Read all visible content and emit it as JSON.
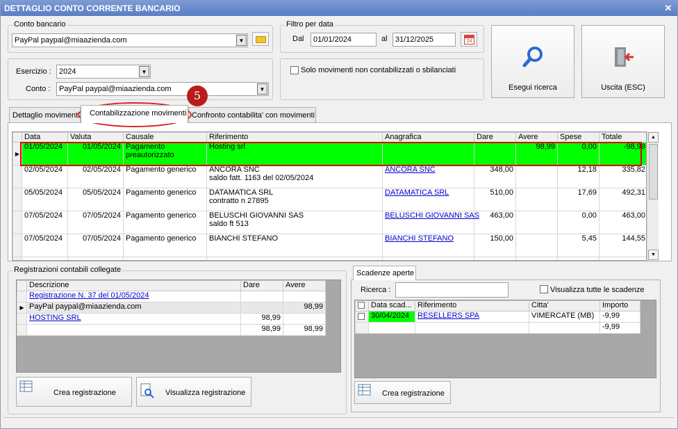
{
  "window": {
    "title": "DETTAGLIO CONTO CORRENTE BANCARIO",
    "close": "✕"
  },
  "conto_bancario": {
    "label": "Conto bancario",
    "value": "PayPal paypal@miaazienda.com"
  },
  "filtro": {
    "label": "Filtro per data",
    "dal_label": "Dal",
    "dal": "01/01/2024",
    "al_label": "al",
    "al": "31/12/2025",
    "cal": "24"
  },
  "esercizio": {
    "label": "Esercizio :",
    "value": "2024"
  },
  "conto": {
    "label": "Conto :",
    "value": "PayPal paypal@miaazienda.com"
  },
  "solo_movimenti": "Solo movimenti non contabilizzati o sbilanciati",
  "buttons": {
    "esegui": "Esegui ricerca",
    "uscita": "Uscita (ESC)"
  },
  "tabs": [
    "Dettaglio movimenti",
    "Contabilizzazione movimenti",
    "Confronto contabilita' con movimenti"
  ],
  "annotation": "5",
  "movimenti": {
    "columns": [
      "Data",
      "Valuta",
      "Causale",
      "Riferimento",
      "Anagrafica",
      "Dare",
      "Avere",
      "Spese",
      "Totale"
    ],
    "rows": [
      {
        "data": "01/05/2024",
        "valuta": "01/05/2024",
        "causale": "Pagamento",
        "causale2": "preautorizzato",
        "rif": "Hosting srl",
        "rif2": "",
        "anag": "",
        "dare": "",
        "avere": "98,99",
        "spese": "0,00",
        "totale": "-98,99"
      },
      {
        "data": "02/05/2024",
        "valuta": "02/05/2024",
        "causale": "Pagamento generico",
        "causale2": "",
        "rif": "ANCORA SNC",
        "rif2": "saldo fatt.   1163 del 02/05/2024",
        "anag": "ANCORA SNC",
        "dare": "348,00",
        "avere": "",
        "spese": "12,18",
        "totale": "335,82"
      },
      {
        "data": "05/05/2024",
        "valuta": "05/05/2024",
        "causale": "Pagamento generico",
        "causale2": "",
        "rif": "DATAMATICA SRL",
        "rif2": "contratto n 27895",
        "anag": "DATAMATICA SRL",
        "dare": "510,00",
        "avere": "",
        "spese": "17,69",
        "totale": "492,31"
      },
      {
        "data": "07/05/2024",
        "valuta": "07/05/2024",
        "causale": "Pagamento generico",
        "causale2": "",
        "rif": "BELUSCHI GIOVANNI SAS",
        "rif2": "saldo ft 513",
        "anag": "BELUSCHI GIOVANNI SAS",
        "dare": "463,00",
        "avere": "",
        "spese": "0,00",
        "totale": "463,00"
      },
      {
        "data": "07/05/2024",
        "valuta": "07/05/2024",
        "causale": "Pagamento generico",
        "causale2": "",
        "rif": "BIANCHI STEFANO",
        "rif2": "",
        "anag": "BIANCHI STEFANO",
        "dare": "150,00",
        "avere": "",
        "spese": "5,45",
        "totale": "144,55"
      }
    ]
  },
  "registrazioni": {
    "label": "Registrazioni contabili collegate",
    "columns": [
      "Descrizione",
      "Dare",
      "Avere"
    ],
    "rows": [
      {
        "desc": "Registrazione N. 37 del 01/05/2024",
        "dare": "",
        "avere": ""
      },
      {
        "desc": "PayPal paypal@miaazienda.com",
        "dare": "",
        "avere": "98,99"
      },
      {
        "desc": "HOSTING SRL",
        "dare": "98,99",
        "avere": ""
      },
      {
        "desc": "",
        "dare": "98,99",
        "avere": "98,99"
      }
    ],
    "btn_crea": "Crea registrazione",
    "btn_visualizza": "Visualizza registrazione"
  },
  "scadenze": {
    "tab": "Scadenze aperte",
    "ricerca_label": "Ricerca :",
    "ricerca_value": "",
    "tutte_label": "Visualizza tutte le scadenze",
    "columns": [
      "Data scad...",
      "Riferimento",
      "Citta'",
      "Importo"
    ],
    "rows": [
      {
        "data": "30/04/2024",
        "rif": "RESELLERS SPA",
        "citta": "VIMERCATE (MB)",
        "importo": "-9,99"
      },
      {
        "data": "",
        "rif": "",
        "citta": "",
        "importo": "-9,99"
      }
    ],
    "btn_crea": "Crea registrazione"
  },
  "colors": {
    "selected_row": "#00ff00",
    "annotation": "#d00000",
    "link": "#0000cc"
  }
}
